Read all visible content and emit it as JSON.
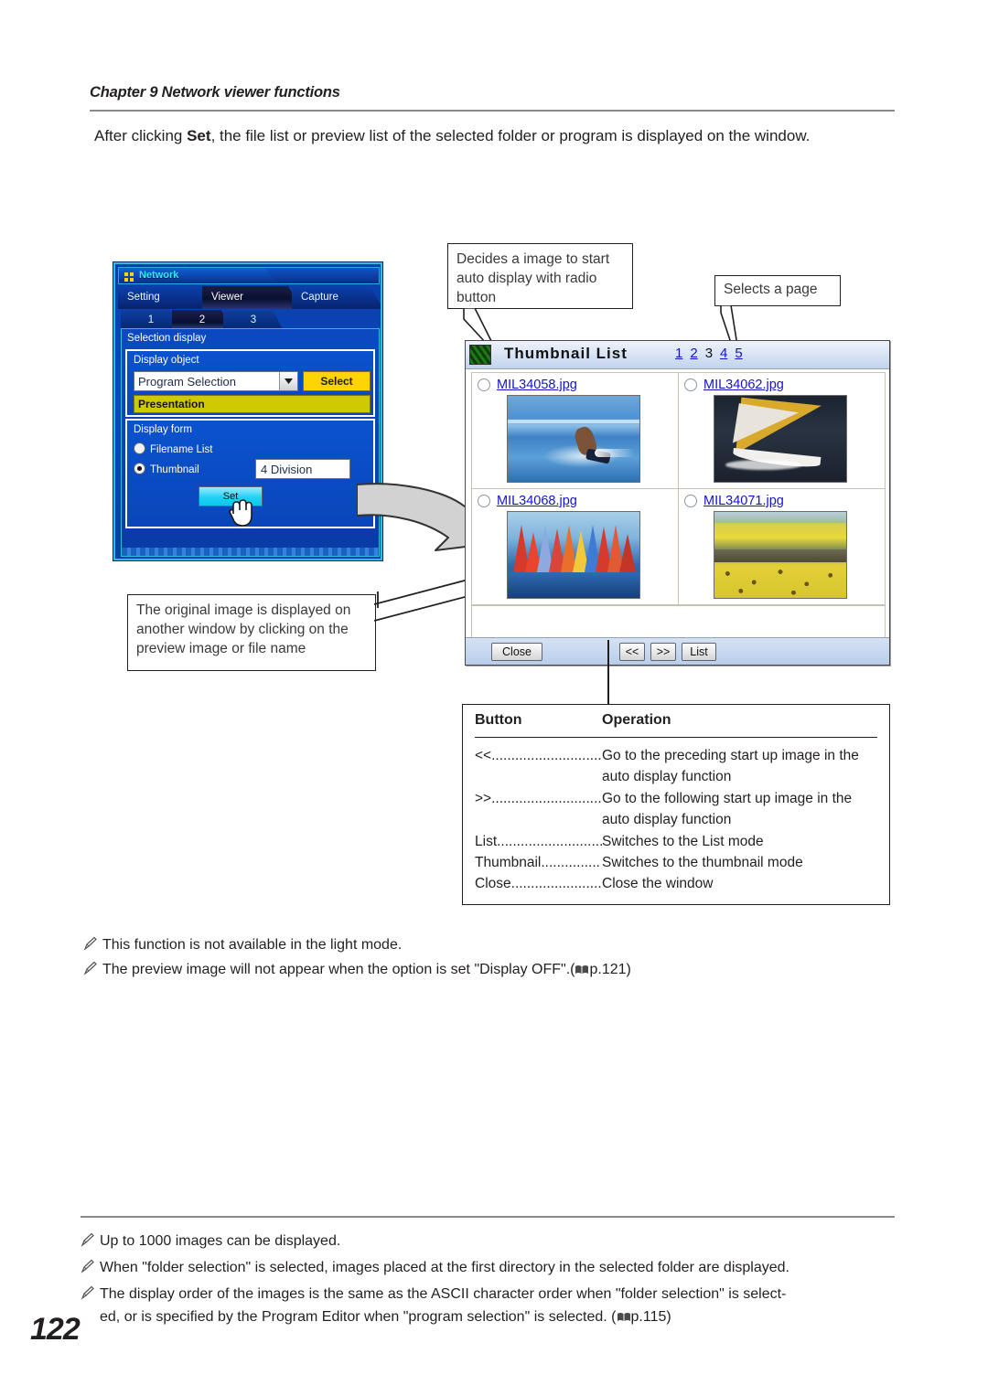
{
  "header": {
    "chapter": "Chapter 9 Network viewer functions"
  },
  "intro": {
    "before": "After clicking ",
    "bold": "Set",
    "after": ", the file list or preview list of the selected folder or program is displayed on the window."
  },
  "app_window": {
    "title": "Network",
    "main_tabs": [
      {
        "label": "Setting",
        "active": false
      },
      {
        "label": "Viewer",
        "active": true
      },
      {
        "label": "Capture",
        "active": false
      }
    ],
    "number_tabs": [
      {
        "label": "1",
        "active": false
      },
      {
        "label": "2",
        "active": true
      },
      {
        "label": "3",
        "active": false
      }
    ],
    "section_caption": "Selection display",
    "display_object": {
      "label": "Display object",
      "combo_value": "Program Selection",
      "select_button": "Select",
      "program_value": "Presentation"
    },
    "display_form": {
      "label": "Display form",
      "options": [
        {
          "label": "Filename List",
          "selected": false
        },
        {
          "label": "Thumbnail",
          "selected": true
        }
      ],
      "division_value": "4 Division",
      "set_button": "Set"
    }
  },
  "callouts": {
    "radio": "Decides a image to start auto display with radio button",
    "page": "Selects a page",
    "original": "The original image is displayed on another window by clicking on the preview image or file name"
  },
  "thumbnail_window": {
    "title": "Thumbnail List",
    "pages": [
      {
        "label": "1",
        "current": false
      },
      {
        "label": "2",
        "current": false
      },
      {
        "label": "3",
        "current": true
      },
      {
        "label": "4",
        "current": false
      },
      {
        "label": "5",
        "current": false
      }
    ],
    "items": [
      {
        "filename": "MIL34058.jpg",
        "selected": false
      },
      {
        "filename": "MIL34062.jpg",
        "selected": false
      },
      {
        "filename": "MIL34068.jpg",
        "selected": false
      },
      {
        "filename": "MIL34071.jpg",
        "selected": false
      }
    ],
    "buttons": {
      "close": "Close",
      "prev": "<<",
      "next": ">>",
      "list": "List"
    }
  },
  "operation_table": {
    "headers": {
      "button": "Button",
      "operation": "Operation"
    },
    "rows": [
      {
        "key": "<<",
        "dots": "...............................",
        "value": "Go to the preceding start up image in the auto display function"
      },
      {
        "key": ">>",
        "dots": "...............................",
        "value": "Go to the following start up image in the auto display function"
      },
      {
        "key": "List",
        "dots": "..............................",
        "value": "Switches to the List mode"
      },
      {
        "key": "Thumbnail",
        "dots": "...............",
        "value": "Switches to the thumbnail mode"
      },
      {
        "key": "Close",
        "dots": "..........................",
        "value": "Close the window"
      }
    ]
  },
  "notes": {
    "note1": "This function is not available in the light mode.",
    "note2_a": "The preview image will not appear when the option is set \"Display OFF\".(",
    "note2_b": "p.121)",
    "note3": "Up to 1000 images can be displayed.",
    "note4": "When \"folder selection\" is selected, images placed at the first directory in the selected folder are displayed.",
    "note5_a": "The display order of the images is the same as the ASCII character order when \"folder selection\" is select-",
    "note5_b": "ed, or is specified by the Program Editor when \"program selection\" is selected. (",
    "note5_c": "p.115)"
  },
  "page_number": "122"
}
